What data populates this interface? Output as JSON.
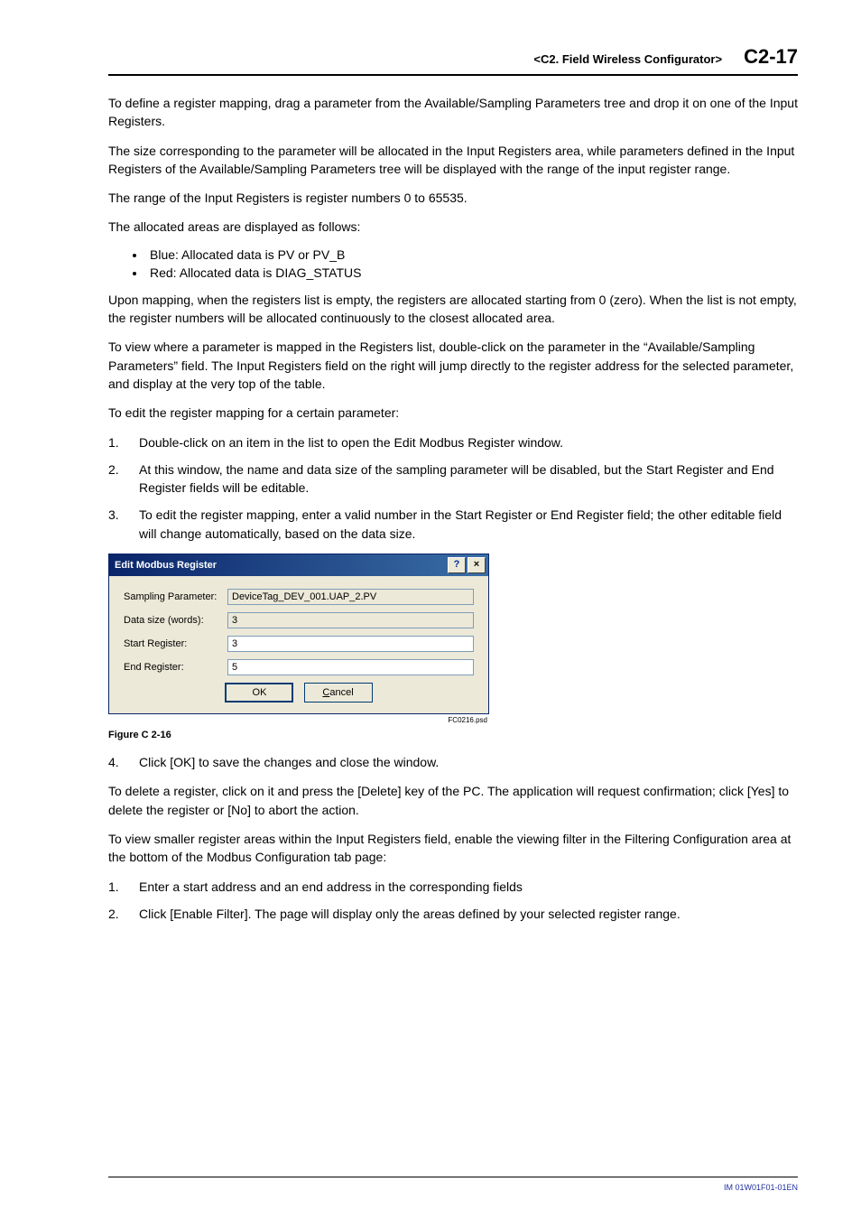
{
  "header": {
    "section": "<C2.  Field Wireless Configurator>",
    "page": "C2-17"
  },
  "paras": {
    "p1": "To define a register mapping, drag a parameter from the Available/Sampling Parameters tree and drop it on one of the Input Registers.",
    "p2": "The size corresponding to the parameter will be allocated in the Input Registers area, while parameters defined in the Input Registers of the Available/Sampling Parameters tree will be displayed with the range of the input register range.",
    "p3": "The range of the Input Registers is register numbers 0 to 65535.",
    "p4": "The allocated areas are displayed as follows:",
    "b1": "Blue: Allocated data is PV or PV_B",
    "b2": "Red: Allocated data is DIAG_STATUS",
    "p5": "Upon mapping, when the registers list is empty, the registers are allocated starting from 0 (zero). When the list is not empty, the register numbers will be allocated continuously to the closest allocated area.",
    "p6": "To view where a parameter is mapped in the Registers list, double-click on the parameter in the “Available/Sampling Parameters” field. The Input Registers field on the right will jump directly to the register address for the selected parameter, and display at the very top of the table.",
    "p7": "To edit the register mapping for a certain parameter:",
    "s1n": "1.",
    "s1": "Double-click on an item in the list to open the Edit Modbus Register window.",
    "s2n": "2.",
    "s2": "At this window, the name and data size of the sampling parameter will be disabled, but the Start Register and End Register fields will be editable.",
    "s3n": "3.",
    "s3": "To edit the register mapping, enter a valid number in the Start Register or End Register field; the other editable field will change automatically, based on the data size.",
    "figcap": "Figure C 2-16",
    "s4n": "4.",
    "s4": "Click [OK] to save the changes and close the window.",
    "p8": "To delete a register, click on it and press the [Delete] key of the PC. The application will request confirmation; click [Yes] to delete the register or [No] to abort the action.",
    "p9": "To view smaller register areas within the Input Registers field, enable the viewing filter in the Filtering Configuration area at the bottom of the Modbus Configuration tab page:",
    "s5n": "1.",
    "s5": "Enter a start address and an end address in the corresponding fields",
    "s6n": "2.",
    "s6": "Click [Enable Filter]. The page will display only the areas defined by your selected register range."
  },
  "dialog": {
    "title": "Edit Modbus Register",
    "help": "?",
    "close": "×",
    "lbl_param": "Sampling Parameter:",
    "val_param": "DeviceTag_DEV_001.UAP_2.PV",
    "lbl_size": "Data size (words):",
    "val_size": "3",
    "lbl_start": "Start Register:",
    "val_start": "3",
    "lbl_end": "End Register:",
    "val_end": "5",
    "ok": "OK",
    "cancel": "Cancel",
    "psd": "FC0216.psd"
  },
  "footer": {
    "code": "IM 01W01F01-01EN"
  }
}
